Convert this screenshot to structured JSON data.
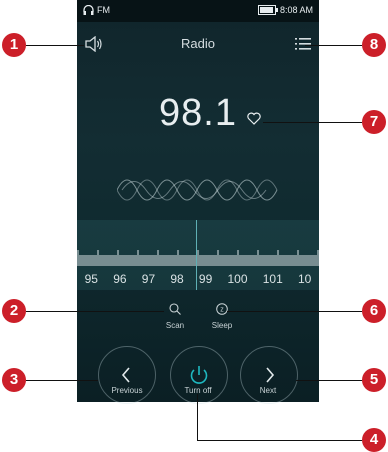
{
  "status_bar": {
    "fm_label": "FM",
    "time": "8:08 AM"
  },
  "header": {
    "title": "Radio"
  },
  "frequency": {
    "value": "98.1"
  },
  "dial": {
    "scale": [
      "95",
      "96",
      "97",
      "98",
      "99",
      "100",
      "101",
      "10"
    ]
  },
  "actions": {
    "scan": "Scan",
    "sleep": "Sleep",
    "sleep_glyph": "z"
  },
  "controls": {
    "previous": "Previous",
    "turn_off": "Turn off",
    "next": "Next"
  },
  "callouts": [
    "1",
    "2",
    "3",
    "4",
    "5",
    "6",
    "7",
    "8"
  ],
  "colors": {
    "accent": "#1fb8c0",
    "callout": "#cc1f29"
  },
  "icons": [
    "speaker-icon",
    "menu-icon",
    "heart-icon",
    "scan-icon",
    "sleep-icon",
    "chevron-left-icon",
    "power-icon",
    "chevron-right-icon",
    "headphones-icon"
  ]
}
